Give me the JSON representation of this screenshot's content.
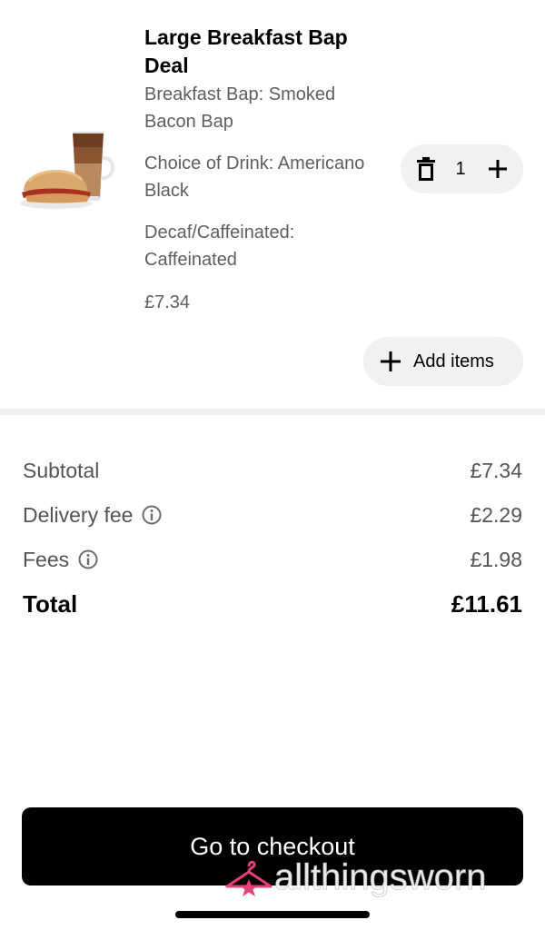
{
  "cart_item": {
    "title": "Large Breakfast Bap Deal",
    "options": [
      "Breakfast Bap: Smoked Bacon Bap",
      "Choice of Drink: Americano Black",
      "Decaf/Caffeinated: Caffeinated"
    ],
    "price": "£7.34",
    "quantity": "1",
    "image_icon": "breakfast-bap-and-coffee-image"
  },
  "add_items": {
    "label": "Add items",
    "icon": "plus-icon"
  },
  "summary": {
    "subtotal_label": "Subtotal",
    "subtotal_value": "£7.34",
    "delivery_label": "Delivery fee",
    "delivery_value": "£2.29",
    "fees_label": "Fees",
    "fees_value": "£1.98",
    "total_label": "Total",
    "total_value": "£11.61"
  },
  "checkout": {
    "label": "Go to checkout"
  },
  "watermark": {
    "text": "allthingsworn"
  },
  "colors": {
    "primary": "#000000",
    "secondary_text": "#5e5e5e",
    "pill_background": "#f1f1f1",
    "divider": "#f2f2f2",
    "watermark_accent": "#e8407a"
  }
}
